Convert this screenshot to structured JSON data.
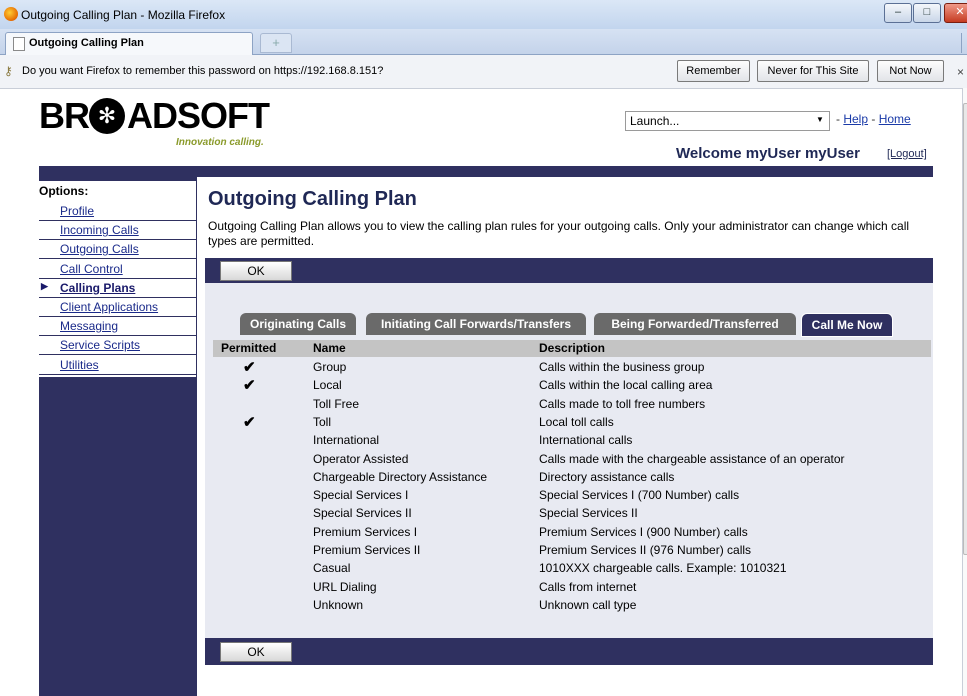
{
  "browser": {
    "window_title": "Outgoing Calling Plan - Mozilla Firefox",
    "tab_label": "Outgoing Calling Plan",
    "new_tab": "+",
    "controls": {
      "minimize": "–",
      "maximize": "□",
      "close": "✕"
    }
  },
  "notification": {
    "message": "Do you want Firefox to remember this password on https://192.168.8.151?",
    "remember": "Remember",
    "never": "Never for This Site",
    "not_now": "Not Now",
    "close": "×"
  },
  "header": {
    "logo_text": "BR",
    "logo_text2": "ADSOFT",
    "logo_star": "✻",
    "logo_tagline": "Innovation calling.",
    "launch_value": "Launch...",
    "help": "Help",
    "home": "Home",
    "separator": "-",
    "welcome": "Welcome myUser myUser",
    "logout": "[Logout]"
  },
  "sidebar": {
    "options_label": "Options:",
    "items": [
      {
        "label": "Profile"
      },
      {
        "label": "Incoming Calls"
      },
      {
        "label": "Outgoing Calls"
      },
      {
        "label": "Call Control"
      },
      {
        "label": "Calling Plans"
      },
      {
        "label": "Client Applications"
      },
      {
        "label": "Messaging"
      },
      {
        "label": "Service Scripts"
      },
      {
        "label": "Utilities"
      }
    ],
    "active_index": 4
  },
  "main": {
    "title": "Outgoing Calling Plan",
    "description": "Outgoing Calling Plan allows you to view the calling plan rules for your outgoing calls. Only your administrator can change which call types are permitted.",
    "ok_label": "OK",
    "tabs": [
      {
        "label": "Originating Calls"
      },
      {
        "label": "Initiating Call Forwards/Transfers"
      },
      {
        "label": "Being Forwarded/Transferred"
      },
      {
        "label": "Call Me Now"
      }
    ],
    "table": {
      "headers": {
        "permitted": "Permitted",
        "name": "Name",
        "description": "Description"
      },
      "check_mark": "✔",
      "rows": [
        {
          "permitted": "✔",
          "name": "Group",
          "description": "Calls within the business group"
        },
        {
          "permitted": "✔",
          "name": "Local",
          "description": "Calls within the local calling area"
        },
        {
          "permitted": "",
          "name": "Toll Free",
          "description": "Calls made to toll free numbers"
        },
        {
          "permitted": "✔",
          "name": "Toll",
          "description": "Local toll calls"
        },
        {
          "permitted": "",
          "name": "International",
          "description": "International calls"
        },
        {
          "permitted": "",
          "name": "Operator Assisted",
          "description": "Calls made with the chargeable assistance of an operator"
        },
        {
          "permitted": "",
          "name": "Chargeable Directory Assistance",
          "description": "Directory assistance calls"
        },
        {
          "permitted": "",
          "name": "Special Services I",
          "description": "Special Services I (700 Number) calls"
        },
        {
          "permitted": "",
          "name": "Special Services II",
          "description": "Special Services II"
        },
        {
          "permitted": "",
          "name": "Premium Services I",
          "description": "Premium Services I (900 Number) calls"
        },
        {
          "permitted": "",
          "name": "Premium Services II",
          "description": "Premium Services II (976 Number) calls"
        },
        {
          "permitted": "",
          "name": "Casual",
          "description": "1010XXX chargeable calls. Example: 1010321"
        },
        {
          "permitted": "",
          "name": "URL Dialing",
          "description": "Calls from internet"
        },
        {
          "permitted": "",
          "name": "Unknown",
          "description": "Unknown call type"
        }
      ]
    }
  }
}
